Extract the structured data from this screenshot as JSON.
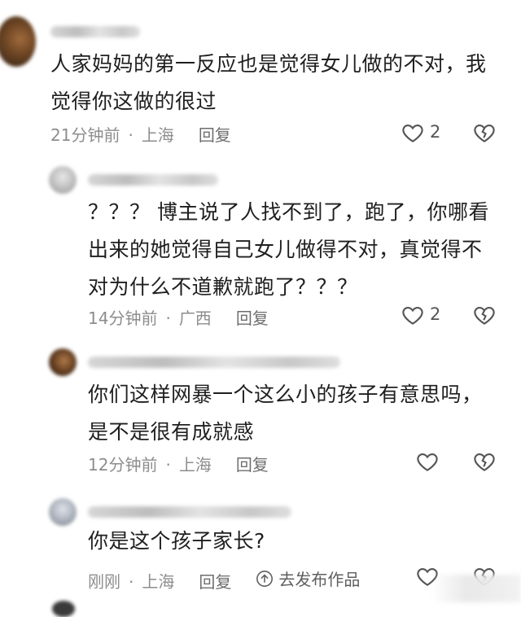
{
  "comments": [
    {
      "text": "人家妈妈的第一反应也是觉得女儿做的不对，我\n觉得你这做的很过",
      "time": "21分钟前",
      "location": "上海",
      "reply_label": "回复",
      "like_count": "2"
    },
    {
      "text": "？？？ 博主说了人找不到了，跑了，你哪看\n出来的她觉得自己女儿做得不对，真觉得不\n对为什么不道歉就跑了？？？",
      "time": "14分钟前",
      "location": "广西",
      "reply_label": "回复",
      "like_count": "2"
    },
    {
      "text": "你们这样网暴一个这么小的孩子有意思吗，\n是不是很有成就感",
      "time": "12分钟前",
      "location": "上海",
      "reply_label": "回复"
    },
    {
      "text": "你是这个孩子家长?",
      "time": "刚刚",
      "location": "上海",
      "reply_label": "回复",
      "goto_label": "去发布作品"
    }
  ],
  "separator": "·",
  "colors": {
    "text": "#1f1f1f",
    "meta": "#8d8d8d",
    "icon": "#555555"
  },
  "icons": [
    "heart-outline-icon",
    "broken-heart-icon",
    "arrow-up-circle-icon"
  ]
}
